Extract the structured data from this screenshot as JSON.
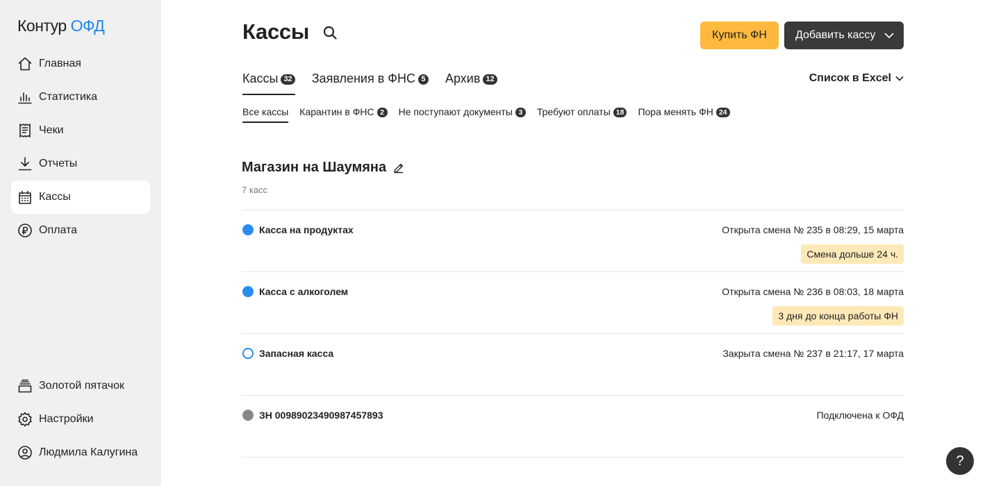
{
  "logo": {
    "part1": "Контур",
    "part2": "ОФД"
  },
  "sidebar": {
    "items": [
      {
        "label": "Главная",
        "icon": "home-icon"
      },
      {
        "label": "Статистика",
        "icon": "bar-chart-icon"
      },
      {
        "label": "Чеки",
        "icon": "receipt-icon"
      },
      {
        "label": "Отчеты",
        "icon": "download-icon"
      },
      {
        "label": "Кассы",
        "icon": "calendar-register-icon",
        "active": true
      },
      {
        "label": "Оплата",
        "icon": "ruble-icon"
      }
    ],
    "bottom_items": [
      {
        "label": "Золотой пятачок",
        "icon": "coins-icon"
      },
      {
        "label": "Настройки",
        "icon": "gear-icon"
      },
      {
        "label": "Людмила Калугина",
        "icon": "user-icon"
      }
    ]
  },
  "header": {
    "title": "Кассы",
    "buy_button": "Купить ФН",
    "add_button": "Добавить кассу"
  },
  "tabs": [
    {
      "label": "Кассы",
      "count": "32",
      "active": true
    },
    {
      "label": "Заявления в ФНС",
      "count": "5"
    },
    {
      "label": "Архив",
      "count": "12"
    }
  ],
  "excel_label": "Список в Excel",
  "subtabs": [
    {
      "label": "Все кассы",
      "count": "",
      "active": true
    },
    {
      "label": "Карантин в ФНС",
      "count": "2"
    },
    {
      "label": "Не поступают документы",
      "count": "3"
    },
    {
      "label": "Требуют оплаты",
      "count": "18"
    },
    {
      "label": "Пора менять ФН",
      "count": "24"
    }
  ],
  "store": {
    "name": "Магазин на Шаумяна",
    "count": "7 касс"
  },
  "registers": [
    {
      "name": "Касса на продуктах",
      "status": "Открыта смена № 235 в 08:29, 15 марта",
      "warning": "Смена дольше 24 ч.",
      "state": "open"
    },
    {
      "name": "Касса с алкоголем",
      "status": "Открыта смена № 236 в 08:03, 18 марта",
      "warning": "3 дня до конца работы ФН",
      "state": "open"
    },
    {
      "name": "Запасная касса",
      "status": "Закрыта смена № 237 в 21:17, 17 марта",
      "warning": "",
      "state": "closed"
    },
    {
      "name": "ЗН 00989023490987457893",
      "status": "Подключена к ОФД",
      "warning": "",
      "state": "gray"
    }
  ],
  "help_label": "?",
  "colors": {
    "accent": "#1f87ef",
    "buy": "#fcb93e",
    "dark": "#3a3a3a",
    "warning_bg": "#fde9b8"
  }
}
